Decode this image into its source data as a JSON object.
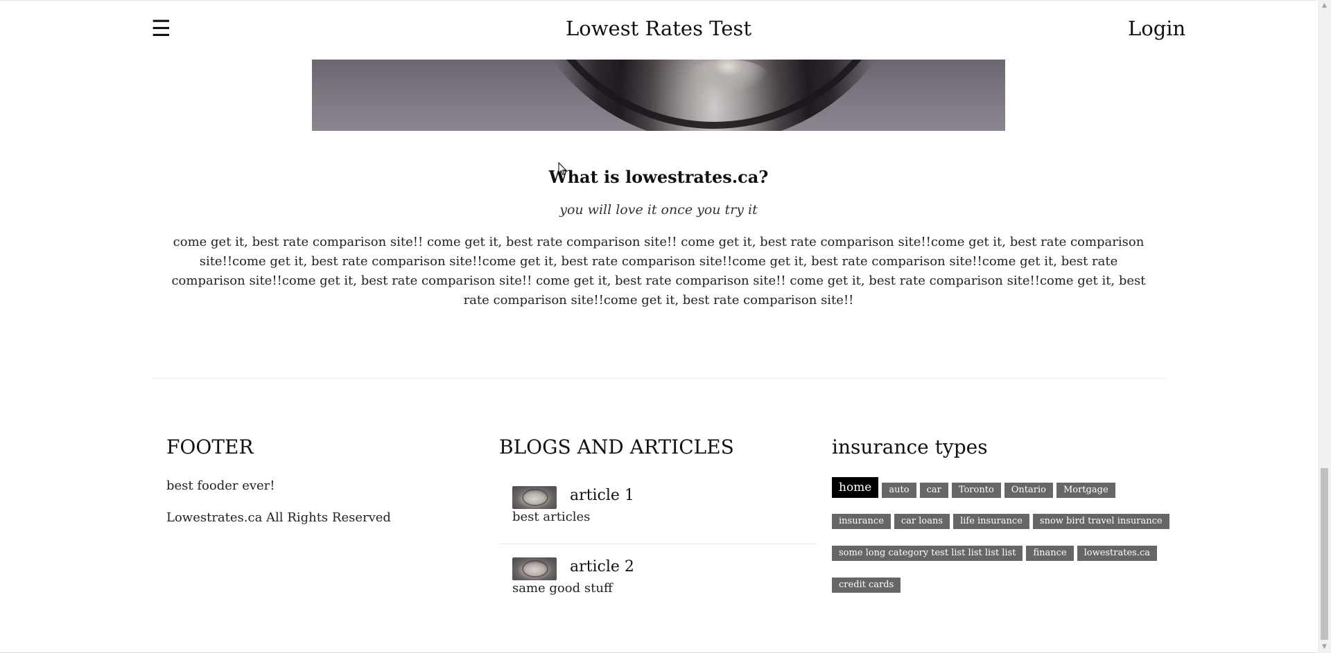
{
  "header": {
    "menu_icon": "☰",
    "title": "Lowest Rates Test",
    "login": "Login"
  },
  "intro": {
    "title": "What is lowestrates.ca?",
    "subtitle": "you will love it once you try it",
    "body": "come get it, best rate comparison site!! come get it, best rate comparison site!! come get it, best rate comparison site!!come get it, best rate comparison site!!come get it, best rate comparison site!!come get it, best rate comparison site!!come get it, best rate comparison site!!come get it, best rate comparison site!!come get it, best rate comparison site!! come get it, best rate comparison site!! come get it, best rate comparison site!!come get it, best rate comparison site!!come get it, best rate comparison site!!"
  },
  "footer": {
    "col1": {
      "title": "FOOTER",
      "tagline": "best fooder ever!",
      "rights": "Lowestrates.ca All Rights Reserved"
    },
    "col2": {
      "title": "BLOGS AND ARTICLES",
      "articles": [
        {
          "title": "article 1",
          "desc": "best articles"
        },
        {
          "title": "article 2",
          "desc": "same good stuff"
        }
      ]
    },
    "col3": {
      "title": "insurance types",
      "tags": [
        "home",
        "auto",
        "car",
        "Toronto",
        "Ontario",
        "Mortgage",
        "insurance",
        "car loans",
        "life insurance",
        "snow bird travel insurance",
        "some long category test list list list list",
        "finance",
        "lowestrates.ca",
        "credit cards"
      ]
    }
  },
  "scrollbar": {
    "up_icon": "▲",
    "down_icon": "▼"
  },
  "colors": {
    "tag_bg": "#666666",
    "tag_active_bg": "#000000"
  }
}
